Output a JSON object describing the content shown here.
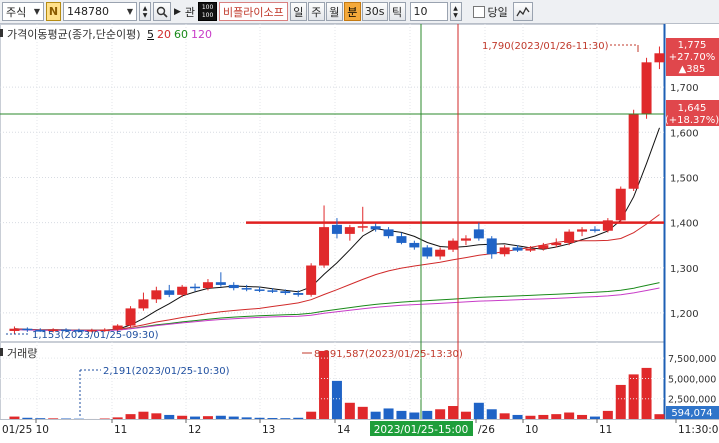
{
  "toolbar": {
    "market": "주식",
    "n_badge": "N",
    "code": "148780",
    "gwan": "관",
    "box_top": "100",
    "box_bottom": "100",
    "stock_name": "비플라이소프",
    "periods": [
      "일",
      "주",
      "월",
      "분",
      "30s",
      "틱"
    ],
    "active_period": "분",
    "interval": "10",
    "today_label": "당일"
  },
  "legend": {
    "title": "가격이동평균(종가,단순이평)",
    "periods": [
      {
        "label": "5",
        "color": "#111111"
      },
      {
        "label": "20",
        "color": "#d12a2a"
      },
      {
        "label": "60",
        "color": "#1a8a1a"
      },
      {
        "label": "120",
        "color": "#c83cc8"
      }
    ]
  },
  "annotations": {
    "high": "1,790(2023/01/26-11:30)",
    "low": "1,153(2023/01/25-09:30)",
    "vol_high": "8,391,587(2023/01/25-13:30)",
    "vol_low": "2,191(2023/01/25-10:30)"
  },
  "price_axis": {
    "ticks": [
      "1,700",
      "1,600",
      "1,500",
      "1,400",
      "1,300",
      "1,200"
    ],
    "current_price": "1,775",
    "current_change": "+27.70%",
    "current_diff": "▲385",
    "cross_price": "1,645",
    "cross_change": "(+18.37%)",
    "current_color": "#e0474c",
    "cross_color": "#e0474c"
  },
  "volume": {
    "title": "거래량",
    "ticks": [
      "7,500,000",
      "5,000,000",
      "2,500,000"
    ],
    "current": "594,074"
  },
  "time_axis": {
    "labels": [
      "01/25 10",
      "11",
      "12",
      "13",
      "14",
      "/26",
      "10",
      "11",
      "11:30:00"
    ],
    "crosshair": "2023/01/25-15:00"
  },
  "chart_data": {
    "type": "candlestick",
    "ylim": [
      1140,
      1800
    ],
    "volume_ylim": [
      0,
      9000000
    ],
    "candles": [
      {
        "t": "01/25 09:30",
        "o": 1160,
        "h": 1170,
        "l": 1153,
        "c": 1165,
        "v": 300000
      },
      {
        "t": "01/25 09:40",
        "o": 1165,
        "h": 1168,
        "l": 1158,
        "c": 1162,
        "v": 150000
      },
      {
        "t": "01/25 09:50",
        "o": 1162,
        "h": 1166,
        "l": 1158,
        "c": 1160,
        "v": 100000
      },
      {
        "t": "01/25 10:00",
        "o": 1160,
        "h": 1166,
        "l": 1157,
        "c": 1163,
        "v": 80000
      },
      {
        "t": "01/25 10:10",
        "o": 1163,
        "h": 1166,
        "l": 1158,
        "c": 1162,
        "v": 60000
      },
      {
        "t": "01/25 10:20",
        "o": 1162,
        "h": 1165,
        "l": 1157,
        "c": 1160,
        "v": 40000
      },
      {
        "t": "01/25 10:30",
        "o": 1160,
        "h": 1165,
        "l": 1157,
        "c": 1162,
        "v": 2191
      },
      {
        "t": "01/25 10:40",
        "o": 1162,
        "h": 1166,
        "l": 1158,
        "c": 1163,
        "v": 60000
      },
      {
        "t": "01/25 10:50",
        "o": 1163,
        "h": 1175,
        "l": 1160,
        "c": 1172,
        "v": 200000
      },
      {
        "t": "01/25 11:00",
        "o": 1172,
        "h": 1215,
        "l": 1168,
        "c": 1210,
        "v": 600000
      },
      {
        "t": "01/25 11:10",
        "o": 1210,
        "h": 1245,
        "l": 1205,
        "c": 1230,
        "v": 900000
      },
      {
        "t": "01/25 11:20",
        "o": 1230,
        "h": 1258,
        "l": 1222,
        "c": 1250,
        "v": 700000
      },
      {
        "t": "01/25 11:30",
        "o": 1250,
        "h": 1262,
        "l": 1235,
        "c": 1240,
        "v": 500000
      },
      {
        "t": "01/25 11:40",
        "o": 1240,
        "h": 1262,
        "l": 1235,
        "c": 1258,
        "v": 400000
      },
      {
        "t": "01/25 11:50",
        "o": 1258,
        "h": 1265,
        "l": 1248,
        "c": 1255,
        "v": 300000
      },
      {
        "t": "01/25 12:00",
        "o": 1255,
        "h": 1275,
        "l": 1250,
        "c": 1268,
        "v": 350000
      },
      {
        "t": "01/25 12:10",
        "o": 1268,
        "h": 1290,
        "l": 1258,
        "c": 1262,
        "v": 400000
      },
      {
        "t": "01/25 12:20",
        "o": 1262,
        "h": 1268,
        "l": 1250,
        "c": 1255,
        "v": 300000
      },
      {
        "t": "01/25 12:30",
        "o": 1255,
        "h": 1262,
        "l": 1248,
        "c": 1252,
        "v": 200000
      },
      {
        "t": "01/25 12:40",
        "o": 1252,
        "h": 1258,
        "l": 1246,
        "c": 1250,
        "v": 150000
      },
      {
        "t": "01/25 12:50",
        "o": 1250,
        "h": 1255,
        "l": 1244,
        "c": 1248,
        "v": 120000
      },
      {
        "t": "01/25 13:00",
        "o": 1248,
        "h": 1252,
        "l": 1240,
        "c": 1244,
        "v": 100000
      },
      {
        "t": "01/25 13:10",
        "o": 1244,
        "h": 1250,
        "l": 1236,
        "c": 1240,
        "v": 150000
      },
      {
        "t": "01/25 13:20",
        "o": 1240,
        "h": 1310,
        "l": 1236,
        "c": 1305,
        "v": 900000
      },
      {
        "t": "01/25 13:30",
        "o": 1305,
        "h": 1438,
        "l": 1300,
        "c": 1390,
        "v": 8391587
      },
      {
        "t": "01/25 13:40",
        "o": 1395,
        "h": 1410,
        "l": 1365,
        "c": 1375,
        "v": 4700000
      },
      {
        "t": "01/25 13:50",
        "o": 1375,
        "h": 1395,
        "l": 1360,
        "c": 1390,
        "v": 2000000
      },
      {
        "t": "01/25 14:00",
        "o": 1390,
        "h": 1435,
        "l": 1380,
        "c": 1392,
        "v": 1500000
      },
      {
        "t": "01/25 14:10",
        "o": 1392,
        "h": 1398,
        "l": 1380,
        "c": 1385,
        "v": 900000
      },
      {
        "t": "01/25 14:20",
        "o": 1385,
        "h": 1390,
        "l": 1365,
        "c": 1370,
        "v": 1300000
      },
      {
        "t": "01/25 14:30",
        "o": 1370,
        "h": 1378,
        "l": 1352,
        "c": 1355,
        "v": 1000000
      },
      {
        "t": "01/25 14:40",
        "o": 1355,
        "h": 1360,
        "l": 1340,
        "c": 1345,
        "v": 800000
      },
      {
        "t": "01/25 14:50",
        "o": 1345,
        "h": 1350,
        "l": 1320,
        "c": 1325,
        "v": 1000000
      },
      {
        "t": "01/25 15:00",
        "o": 1325,
        "h": 1345,
        "l": 1318,
        "c": 1340,
        "v": 1200000
      },
      {
        "t": "01/25 15:10",
        "o": 1340,
        "h": 1365,
        "l": 1335,
        "c": 1360,
        "v": 1600000
      },
      {
        "t": "01/25 15:20",
        "o": 1360,
        "h": 1372,
        "l": 1350,
        "c": 1365,
        "v": 900000
      },
      {
        "t": "01/26 09:10",
        "o": 1385,
        "h": 1400,
        "l": 1360,
        "c": 1365,
        "v": 2000000
      },
      {
        "t": "01/26 09:20",
        "o": 1365,
        "h": 1370,
        "l": 1320,
        "c": 1330,
        "v": 1200000
      },
      {
        "t": "01/26 09:30",
        "o": 1330,
        "h": 1350,
        "l": 1325,
        "c": 1345,
        "v": 700000
      },
      {
        "t": "01/26 09:40",
        "o": 1345,
        "h": 1350,
        "l": 1335,
        "c": 1338,
        "v": 500000
      },
      {
        "t": "01/26 09:50",
        "o": 1338,
        "h": 1348,
        "l": 1335,
        "c": 1342,
        "v": 400000
      },
      {
        "t": "01/26 10:00",
        "o": 1342,
        "h": 1355,
        "l": 1338,
        "c": 1350,
        "v": 500000
      },
      {
        "t": "01/26 10:10",
        "o": 1350,
        "h": 1365,
        "l": 1345,
        "c": 1355,
        "v": 600000
      },
      {
        "t": "01/26 10:20",
        "o": 1355,
        "h": 1385,
        "l": 1350,
        "c": 1380,
        "v": 800000
      },
      {
        "t": "01/26 10:30",
        "o": 1380,
        "h": 1390,
        "l": 1370,
        "c": 1385,
        "v": 500000
      },
      {
        "t": "01/26 10:40",
        "o": 1385,
        "h": 1392,
        "l": 1378,
        "c": 1382,
        "v": 300000
      },
      {
        "t": "01/26 10:50",
        "o": 1382,
        "h": 1410,
        "l": 1378,
        "c": 1405,
        "v": 1000000
      },
      {
        "t": "01/26 11:00",
        "o": 1405,
        "h": 1480,
        "l": 1400,
        "c": 1475,
        "v": 4200000
      },
      {
        "t": "01/26 11:10",
        "o": 1475,
        "h": 1650,
        "l": 1470,
        "c": 1640,
        "v": 5500000
      },
      {
        "t": "01/26 11:20",
        "o": 1640,
        "h": 1765,
        "l": 1630,
        "c": 1755,
        "v": 6300000
      },
      {
        "t": "01/26 11:30",
        "o": 1755,
        "h": 1790,
        "l": 1740,
        "c": 1775,
        "v": 594074
      }
    ],
    "resistance": 1400
  }
}
